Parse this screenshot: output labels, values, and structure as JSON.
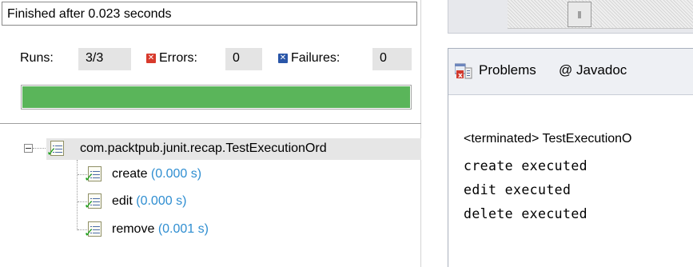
{
  "junit": {
    "status": "Finished after 0.023 seconds",
    "runs_label": "Runs:",
    "runs_value": "3/3",
    "errors_label": "Errors:",
    "errors_value": "0",
    "failures_label": "Failures:",
    "failures_value": "0",
    "progress": 1.0,
    "progress_color": "#5ab55a",
    "tree": {
      "suite": "com.packtpub.junit.recap.TestExecutionOrd",
      "tests": [
        {
          "name": "create",
          "time": "(0.000 s)"
        },
        {
          "name": "edit",
          "time": "(0.000 s)"
        },
        {
          "name": "remove",
          "time": "(0.001 s)"
        }
      ]
    }
  },
  "problems_panel": {
    "tabs": [
      {
        "label": "Problems",
        "icon": "problems-icon"
      },
      {
        "label": "@ Javadoc",
        "icon": ""
      }
    ],
    "console": {
      "header": "<terminated> TestExecutionO",
      "lines": [
        "create executed",
        "edit executed",
        "delete executed"
      ]
    }
  }
}
